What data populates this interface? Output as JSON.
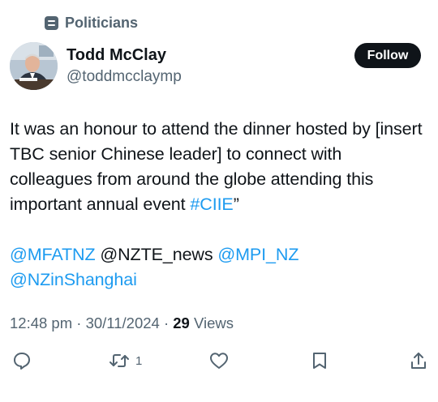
{
  "list_label": {
    "text": "Politicians",
    "icon": "list-icon"
  },
  "author": {
    "display_name": "Todd McClay",
    "handle": "@toddmcclaymp",
    "avatar": "profile-photo"
  },
  "follow_label": "Follow",
  "tweet": {
    "line1_pre": "It was an honour to attend the dinner hosted by [insert TBC senior Chinese leader] to connect with colleagues from around the globe attending this important annual event ",
    "hashtag": "#CIIE",
    "line1_post": "”",
    "mentions": {
      "m1": "@MFATNZ",
      "m2": "@NZTE_news",
      "m3": "@MPI_NZ",
      "m4": "@NZinShanghai"
    }
  },
  "meta": {
    "time": "12:48 pm",
    "date": "30/11/2024",
    "views_count": "29",
    "views_label": "Views",
    "separator": " · "
  },
  "actions": {
    "reply_icon": "reply-icon",
    "retweet_icon": "retweet-icon",
    "retweet_count": "1",
    "like_icon": "heart-icon",
    "bookmark_icon": "bookmark-icon",
    "share_icon": "share-icon"
  },
  "colors": {
    "link": "#1d9bf0",
    "secondary": "#536471",
    "primary": "#0f1419"
  }
}
